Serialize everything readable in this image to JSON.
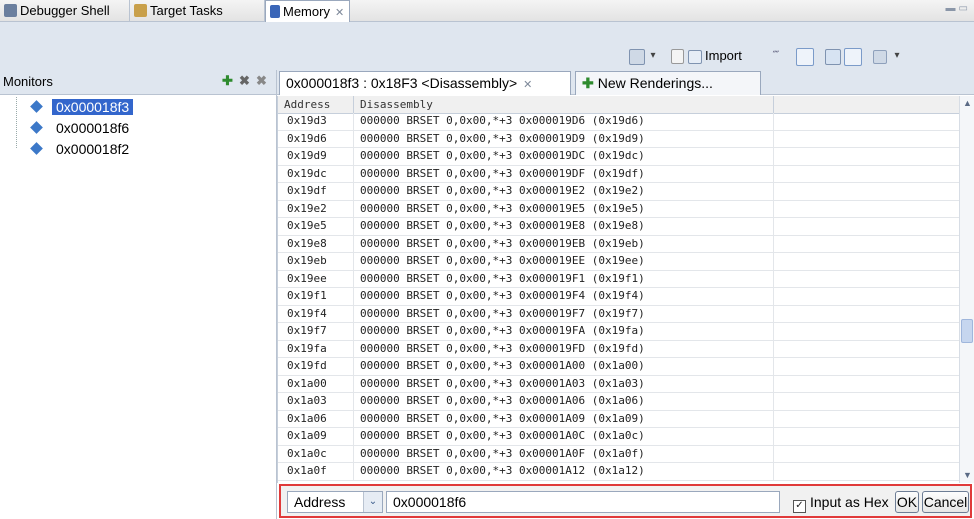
{
  "view_tabs": [
    {
      "label": "Debugger Shell",
      "icon": "debugger-shell-icon",
      "active": false
    },
    {
      "label": "Target Tasks",
      "icon": "target-tasks-icon",
      "active": false
    },
    {
      "label": "Memory",
      "icon": "memory-icon",
      "active": true
    }
  ],
  "toolbar": {
    "import_label": "Import"
  },
  "monitors": {
    "title": "Monitors",
    "items": [
      {
        "label": "0x000018f3",
        "selected": true
      },
      {
        "label": "0x000018f6",
        "selected": false
      },
      {
        "label": "0x000018f2",
        "selected": false
      }
    ]
  },
  "rendering_tabs": {
    "active_label": "0x000018f3 : 0x18F3 <Disassembly>",
    "new_label": "New Renderings..."
  },
  "table": {
    "columns": [
      "Address",
      "Disassembly"
    ],
    "rows": [
      [
        "0x19d3",
        "000000 BRSET 0,0x00,*+3 0x000019D6 (0x19d6)"
      ],
      [
        "0x19d6",
        "000000 BRSET 0,0x00,*+3 0x000019D9 (0x19d9)"
      ],
      [
        "0x19d9",
        "000000 BRSET 0,0x00,*+3 0x000019DC (0x19dc)"
      ],
      [
        "0x19dc",
        "000000 BRSET 0,0x00,*+3 0x000019DF (0x19df)"
      ],
      [
        "0x19df",
        "000000 BRSET 0,0x00,*+3 0x000019E2 (0x19e2)"
      ],
      [
        "0x19e2",
        "000000 BRSET 0,0x00,*+3 0x000019E5 (0x19e5)"
      ],
      [
        "0x19e5",
        "000000 BRSET 0,0x00,*+3 0x000019E8 (0x19e8)"
      ],
      [
        "0x19e8",
        "000000 BRSET 0,0x00,*+3 0x000019EB (0x19eb)"
      ],
      [
        "0x19eb",
        "000000 BRSET 0,0x00,*+3 0x000019EE (0x19ee)"
      ],
      [
        "0x19ee",
        "000000 BRSET 0,0x00,*+3 0x000019F1 (0x19f1)"
      ],
      [
        "0x19f1",
        "000000 BRSET 0,0x00,*+3 0x000019F4 (0x19f4)"
      ],
      [
        "0x19f4",
        "000000 BRSET 0,0x00,*+3 0x000019F7 (0x19f7)"
      ],
      [
        "0x19f7",
        "000000 BRSET 0,0x00,*+3 0x000019FA (0x19fa)"
      ],
      [
        "0x19fa",
        "000000 BRSET 0,0x00,*+3 0x000019FD (0x19fd)"
      ],
      [
        "0x19fd",
        "000000 BRSET 0,0x00,*+3 0x00001A00 (0x1a00)"
      ],
      [
        "0x1a00",
        "000000 BRSET 0,0x00,*+3 0x00001A03 (0x1a03)"
      ],
      [
        "0x1a03",
        "000000 BRSET 0,0x00,*+3 0x00001A06 (0x1a06)"
      ],
      [
        "0x1a06",
        "000000 BRSET 0,0x00,*+3 0x00001A09 (0x1a09)"
      ],
      [
        "0x1a09",
        "000000 BRSET 0,0x00,*+3 0x00001A0C (0x1a0c)"
      ],
      [
        "0x1a0c",
        "000000 BRSET 0,0x00,*+3 0x00001A0F (0x1a0f)"
      ],
      [
        "0x1a0f",
        "000000 BRSET 0,0x00,*+3 0x00001A12 (0x1a12)"
      ]
    ]
  },
  "goto_bar": {
    "mode": "Address",
    "value": "0x000018f6",
    "input_as_hex_label": "Input as Hex",
    "input_as_hex_checked": true,
    "ok_label": "OK",
    "cancel_label": "Cancel"
  },
  "colors": {
    "selection": "#3366cc",
    "highlight_border": "#e03a3a",
    "toolbar_bg": "#dfe6ef"
  }
}
